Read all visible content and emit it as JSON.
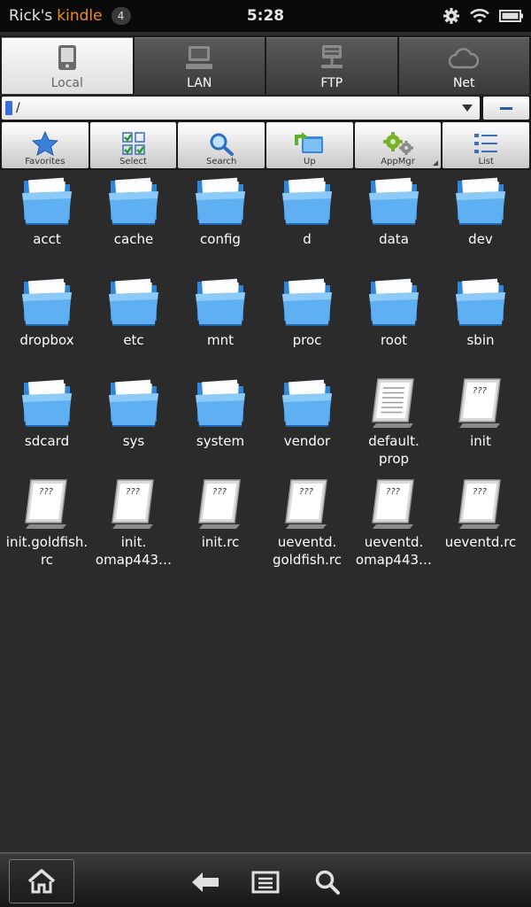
{
  "status": {
    "owner": "Rick's",
    "brand": "kindle",
    "notifications": "4",
    "time": "5:28",
    "icons": [
      "gear-icon",
      "wifi-icon",
      "battery-icon"
    ]
  },
  "tabs": [
    {
      "label": "Local",
      "active": true,
      "icon": "tablet-icon"
    },
    {
      "label": "LAN",
      "active": false,
      "icon": "computer-icon"
    },
    {
      "label": "FTP",
      "active": false,
      "icon": "server-icon"
    },
    {
      "label": "Net",
      "active": false,
      "icon": "cloud-icon"
    }
  ],
  "path": {
    "value": "/"
  },
  "toolbar": {
    "favorites": "Favorites",
    "select": "Select",
    "search": "Search",
    "up": "Up",
    "appmgr": "AppMgr",
    "list": "List"
  },
  "files": [
    {
      "name": "acct",
      "type": "folder"
    },
    {
      "name": "cache",
      "type": "folder"
    },
    {
      "name": "config",
      "type": "folder"
    },
    {
      "name": "d",
      "type": "folder"
    },
    {
      "name": "data",
      "type": "folder"
    },
    {
      "name": "dev",
      "type": "folder"
    },
    {
      "name": "dropbox",
      "type": "folder"
    },
    {
      "name": "etc",
      "type": "folder"
    },
    {
      "name": "mnt",
      "type": "folder"
    },
    {
      "name": "proc",
      "type": "folder"
    },
    {
      "name": "root",
      "type": "folder"
    },
    {
      "name": "sbin",
      "type": "folder"
    },
    {
      "name": "sdcard",
      "type": "folder"
    },
    {
      "name": "sys",
      "type": "folder"
    },
    {
      "name": "system",
      "type": "folder"
    },
    {
      "name": "vendor",
      "type": "folder"
    },
    {
      "name": "default.\nprop",
      "type": "text-file"
    },
    {
      "name": "init",
      "type": "unknown-file"
    },
    {
      "name": "init.goldfish.\nrc",
      "type": "unknown-file"
    },
    {
      "name": "init.\nomap443…",
      "type": "unknown-file"
    },
    {
      "name": "init.rc",
      "type": "unknown-file"
    },
    {
      "name": "ueventd.\ngoldfish.rc",
      "type": "unknown-file"
    },
    {
      "name": "ueventd.\nomap443…",
      "type": "unknown-file"
    },
    {
      "name": "ueventd.rc",
      "type": "unknown-file"
    }
  ],
  "bottom_nav": {
    "icons": [
      "home-icon",
      "back-icon",
      "menu-icon",
      "search-icon"
    ]
  }
}
